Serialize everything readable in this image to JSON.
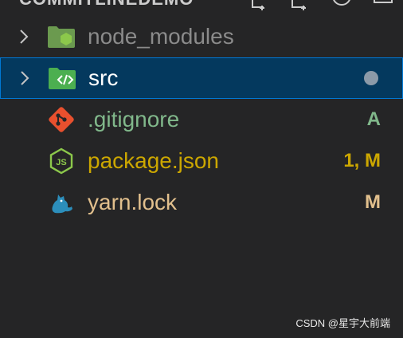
{
  "header": {
    "title": "COMMITLINEDEMO"
  },
  "tree": {
    "items": [
      {
        "label": "node_modules",
        "kind": "folder",
        "icon": "node-folder-icon",
        "badge": "",
        "color": "#8b8b8b"
      },
      {
        "label": "src",
        "kind": "folder",
        "icon": "src-folder-icon",
        "badge": "",
        "color": "#ffffff",
        "selected": true
      },
      {
        "label": ".gitignore",
        "kind": "file",
        "icon": "git-icon",
        "badge": "A",
        "color": "#81b88b"
      },
      {
        "label": "package.json",
        "kind": "file",
        "icon": "nodejs-icon",
        "badge": "1, M",
        "color": "#cca700"
      },
      {
        "label": "yarn.lock",
        "kind": "file",
        "icon": "yarn-icon",
        "badge": "M",
        "color": "#e2c08d"
      }
    ]
  },
  "colors": {
    "background": "#252526",
    "selection": "#04395e",
    "selection_border": "#0078d4",
    "added": "#81b88b",
    "modified_warning": "#cca700",
    "modified": "#e2c08d"
  },
  "watermark": "CSDN @星宇大前端"
}
